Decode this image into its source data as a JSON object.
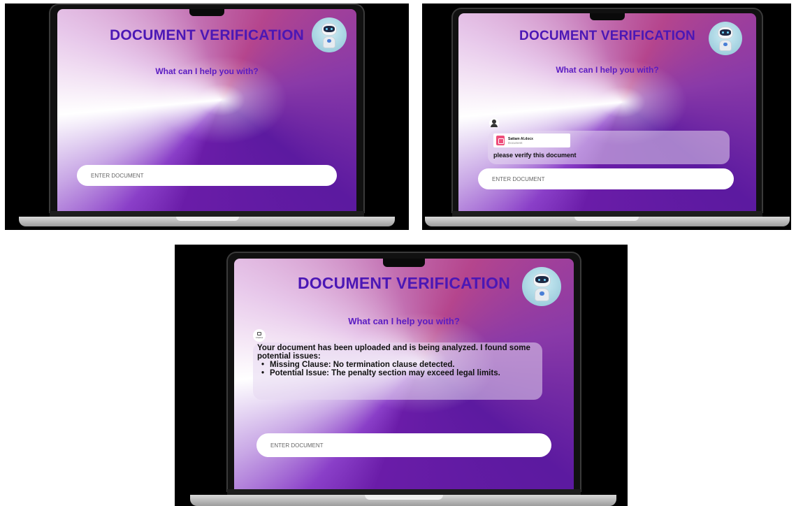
{
  "app": {
    "title": "DOCUMENT VERIFICATION",
    "subtitle": "What can I help you with?",
    "input_placeholder": "ENTER DOCUMENT",
    "robot_avatar_icon": "robot-icon"
  },
  "screens": [
    {
      "state": "empty"
    },
    {
      "state": "user-upload",
      "attachment": {
        "file_name": "Sattam AI.docx",
        "file_type": "Document",
        "icon": "document-icon",
        "icon_color": "#ee4d7a"
      },
      "user_message": "please verify this document"
    },
    {
      "state": "bot-response",
      "bot_avatar_label": "Chatbot",
      "response_intro": "Your document has been uploaded and is being analyzed. I found some potential issues:",
      "issues": [
        "Missing Clause: No termination clause detected.",
        "Potential Issue: The penalty section may exceed legal limits."
      ]
    }
  ],
  "colors": {
    "title": "#4b17b5",
    "subtitle": "#5a1cc2",
    "gradient_dark": "#5c1aa0",
    "gradient_pink": "#b5458d"
  }
}
